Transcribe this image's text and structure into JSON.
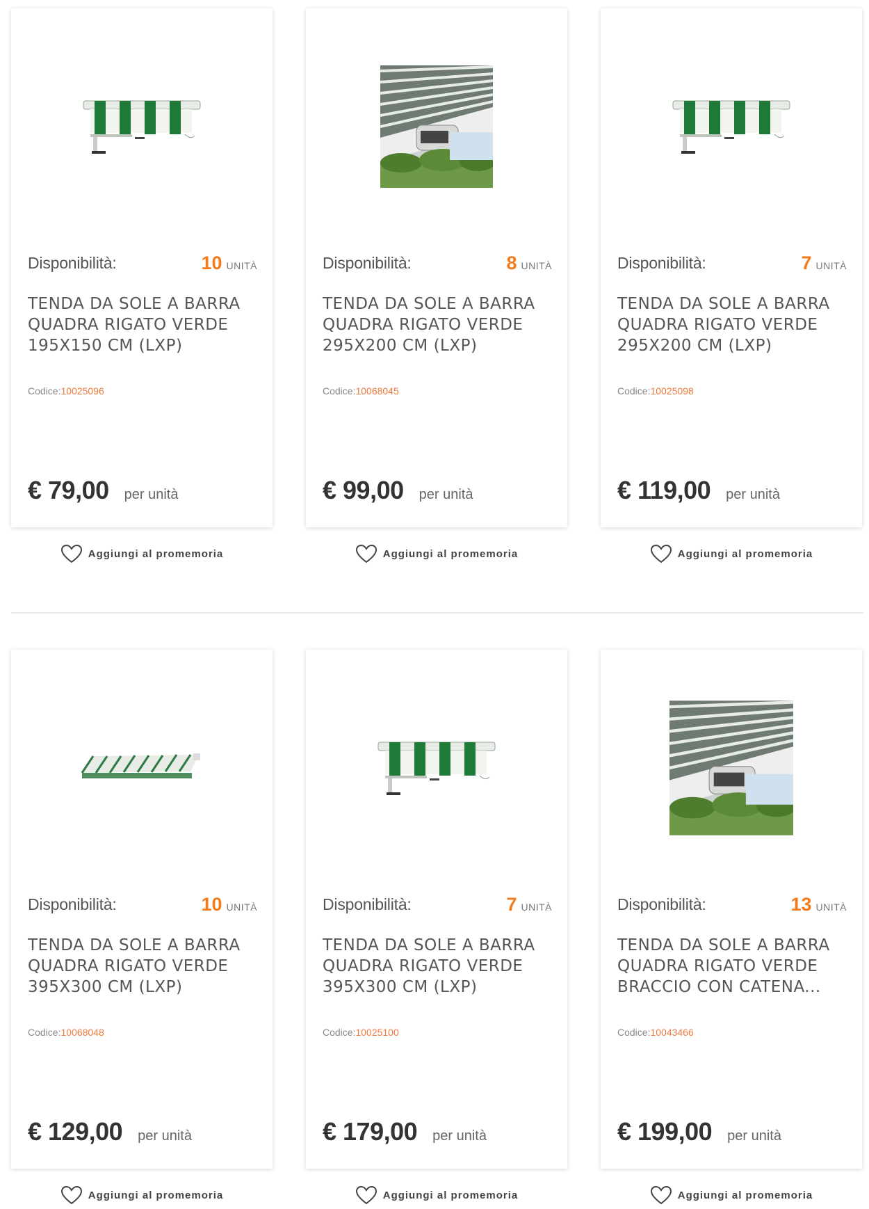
{
  "labels": {
    "availability": "Disponibilità:",
    "unit": "UNITÀ",
    "code_prefix": "Codice:",
    "per_unit": "per unità",
    "wishlist": "Aggiungi al promemoria"
  },
  "products": [
    {
      "qty": "10",
      "title": "TENDA DA SOLE A BARRA QUADRA RIGATO VERDE 195X150 CM (LXP)",
      "code": "10025096",
      "price": "€ 79,00",
      "image": "awning-front"
    },
    {
      "qty": "8",
      "title": "TENDA DA SOLE A BARRA QUADRA RIGATO VERDE 295X200 CM (LXP)",
      "code": "10068045",
      "price": "€ 99,00",
      "image": "awning-photo"
    },
    {
      "qty": "7",
      "title": "TENDA DA SOLE A BARRA QUADRA RIGATO VERDE 295X200 CM (LXP)",
      "code": "10025098",
      "price": "€ 119,00",
      "image": "awning-front"
    },
    {
      "qty": "10",
      "title": "TENDA DA SOLE A BARRA QUADRA RIGATO VERDE 395X300 CM (LXP)",
      "code": "10068048",
      "price": "€ 129,00",
      "image": "awning-open"
    },
    {
      "qty": "7",
      "title": "TENDA DA SOLE A BARRA QUADRA RIGATO VERDE 395X300 CM (LXP)",
      "code": "10025100",
      "price": "€ 179,00",
      "image": "awning-front"
    },
    {
      "qty": "13",
      "title": "TENDA DA SOLE A BARRA QUADRA RIGATO VERDE BRACCIO CON CATENA...",
      "code": "10043466",
      "price": "€ 199,00",
      "image": "awning-photo"
    }
  ],
  "colors": {
    "accent": "#f07c1e",
    "code": "#f0793c"
  }
}
